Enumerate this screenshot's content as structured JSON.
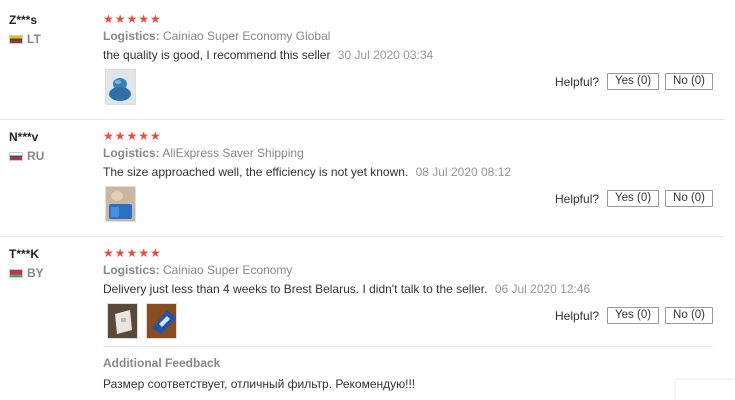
{
  "reviews": [
    {
      "user": "Z***s",
      "country": "LT",
      "stars": "★★★★★",
      "logistics_label": "Logistics:",
      "logistics": "Cainiao Super Economy Global",
      "comment": "the quality is good, I recommend this seller",
      "date": "30 Jul 2020 03:34",
      "helpful_label": "Helpful?",
      "yes": "Yes (0)",
      "no": "No (0)"
    },
    {
      "user": "N***v",
      "country": "RU",
      "stars": "★★★★★",
      "logistics_label": "Logistics:",
      "logistics": "AliExpress Saver Shipping",
      "comment": "The size approached well, the efficiency is not yet known.",
      "date": "08 Jul 2020 08:12",
      "helpful_label": "Helpful?",
      "yes": "Yes (0)",
      "no": "No (0)"
    },
    {
      "user": "T***K",
      "country": "BY",
      "stars": "★★★★★",
      "logistics_label": "Logistics:",
      "logistics": "Cainiao Super Economy",
      "comment": "Delivery just less than 4 weeks to Brest Belarus. I didn't talk to the seller.",
      "date": "06 Jul 2020 12:46",
      "helpful_label": "Helpful?",
      "yes": "Yes (0)",
      "no": "No (0)",
      "additional_title": "Additional Feedback",
      "additional_text": "Размер соответствует, отличный фильтр. Рекомендую!!!"
    }
  ],
  "colors": {
    "stars": "#f04b3a",
    "muted": "#888888",
    "separator": "#e8e8e8"
  }
}
